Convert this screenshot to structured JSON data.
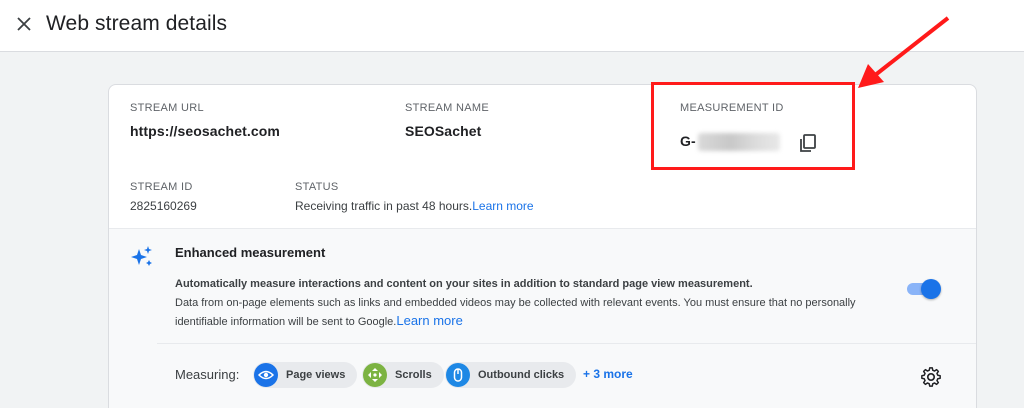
{
  "header": {
    "title": "Web stream details",
    "close_icon": "close-icon"
  },
  "stream": {
    "url_label": "STREAM URL",
    "url_value": "https://seosachet.com",
    "name_label": "STREAM NAME",
    "name_value": "SEOSachet",
    "measurement_label": "MEASUREMENT ID",
    "measurement_prefix": "G-",
    "copy_icon": "copy-icon",
    "id_label": "STREAM ID",
    "id_value": "2825160269",
    "status_label": "STATUS",
    "status_value": "Receiving traffic in past 48 hours.",
    "status_link": "Learn more"
  },
  "enhanced": {
    "icon": "sparkle-icon",
    "title": "Enhanced measurement",
    "desc_bold": "Automatically measure interactions and content on your sites in addition to standard page view measurement.",
    "desc": "Data from on-page elements such as links and embedded videos may be collected with relevant events. You must ensure that no personally identifiable information will be sent to Google.",
    "desc_link": "Learn more",
    "toggle_on": true,
    "measuring_label": "Measuring:",
    "chips": [
      {
        "label": "Page views",
        "icon": "eye-icon",
        "color": "#1a73e8"
      },
      {
        "label": "Scrolls",
        "icon": "scroll-icon",
        "color": "#7cb342"
      },
      {
        "label": "Outbound clicks",
        "icon": "mouse-icon",
        "color": "#1e88e5"
      }
    ],
    "more_link": "+ 3 more",
    "settings_icon": "gear-icon"
  },
  "annotation": {
    "color": "#ff1a1a"
  }
}
